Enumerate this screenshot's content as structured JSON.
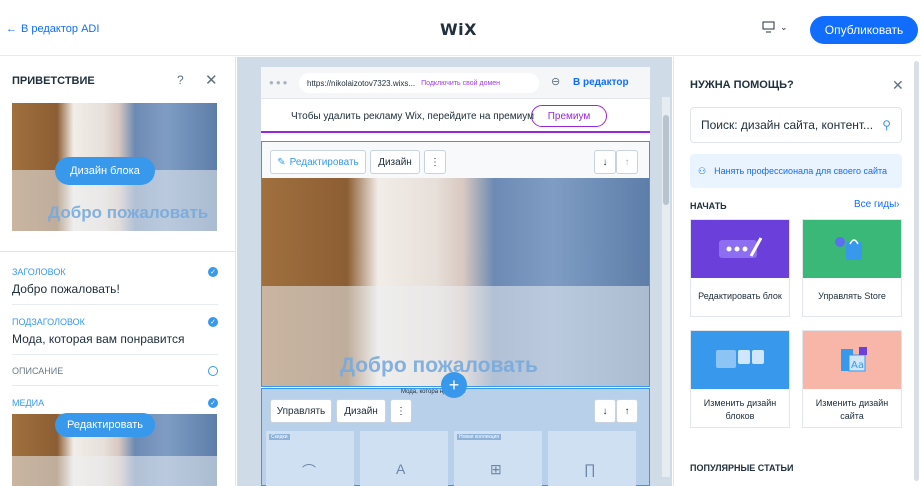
{
  "topbar": {
    "back_label": "В редактор ADI",
    "logo": "WiX",
    "publish_label": "Опубликовать"
  },
  "left_panel": {
    "title": "ПРИВЕТСТВИЕ",
    "help": "?",
    "preview_button": "Дизайн блока",
    "preview_text": "Добро пожаловать",
    "fields": [
      {
        "label": "ЗАГОЛОВОК",
        "value": "Добро пожаловать!",
        "checked": true
      },
      {
        "label": "ПОДЗАГОЛОВОК",
        "value": "Мода, которая вам понравится",
        "checked": true
      },
      {
        "label": "ОПИСАНИЕ",
        "value": "",
        "checked": false
      },
      {
        "label": "МЕДИА",
        "value": "",
        "checked": true
      }
    ],
    "media_button": "Редактировать"
  },
  "canvas": {
    "url": "https://nikolaizotov7323.wixs...",
    "connect_domain": "Подключить свой домен",
    "to_editor": "В редактор",
    "ad_text": "Чтобы удалить рекламу Wix, перейдите на премиум",
    "premium_label": "Премиум",
    "hero_toolbar": {
      "edit": "Редактировать",
      "design": "Дизайн"
    },
    "hero_welcome": "Добро пожаловать",
    "strip_text": "Мода, котора        нравится",
    "second_toolbar": {
      "manage": "Управлять",
      "design": "Дизайн"
    },
    "category_tags": [
      "Скидки",
      "",
      "Новая коллекция",
      ""
    ]
  },
  "right_panel": {
    "title": "НУЖНА ПОМОЩЬ?",
    "search_placeholder": "Поиск: дизайн сайта, контент...",
    "hire_label": "Нанять профессионала для своего сайта",
    "start_label": "НАЧАТЬ",
    "all_guides": "Все гиды",
    "cards": [
      {
        "label": "Редактировать блок",
        "color": "#6b3fd9"
      },
      {
        "label": "Управлять Store",
        "color": "#39b878"
      },
      {
        "label": "Изменить дизайн блоков",
        "color": "#3899ec"
      },
      {
        "label": "Изменить дизайн сайта",
        "color": "#f7b6a8"
      }
    ],
    "popular_label": "ПОПУЛЯРНЫЕ СТАТЬИ"
  }
}
